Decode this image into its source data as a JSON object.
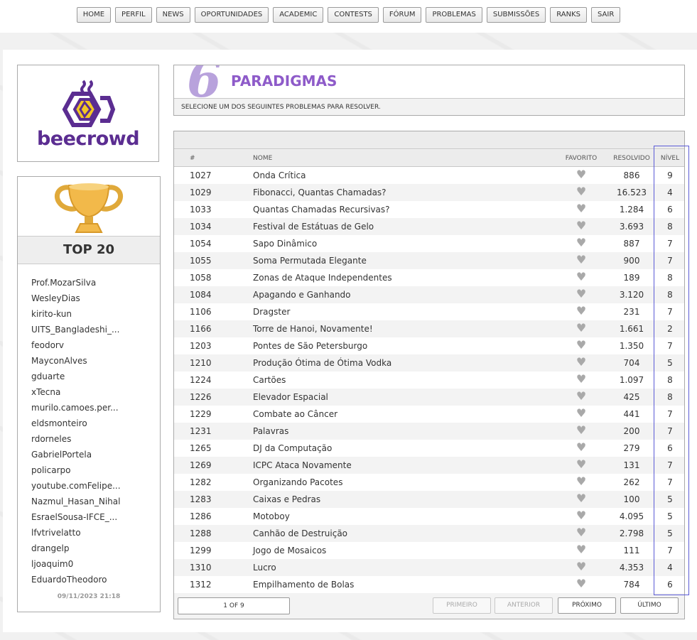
{
  "nav": [
    "HOME",
    "PERFIL",
    "NEWS",
    "OPORTUNIDADES",
    "ACADEMIC",
    "CONTESTS",
    "FÓRUM",
    "PROBLEMAS",
    "SUBMISSÕES",
    "RANKS",
    "SAIR"
  ],
  "logo": {
    "text": "beecrowd",
    "color": "#5b2d91"
  },
  "top": {
    "title": "TOP 20",
    "users": [
      "Prof.MozarSilva",
      "WesleyDias",
      "kirito-kun",
      "UITS_Bangladeshi_...",
      "feodorv",
      "MayconAlves",
      "gduarte",
      "xTecna",
      "murilo.camoes.per...",
      "eldsmonteiro",
      "rdorneles",
      "GabrielPortela",
      "policarpo",
      "youtube.comFelipe...",
      "Nazmul_Hasan_Nihal",
      "EsraelSousa-IFCE_...",
      "lfvtrivelatto",
      "drangelp",
      "ljoaquim0",
      "EduardoTheodoro"
    ],
    "date": "09/11/2023 21:18"
  },
  "category": {
    "number": "6",
    "title": "PARADIGMAS",
    "subtitle": "SELECIONE UM DOS SEGUINTES PROBLEMAS PARA RESOLVER.",
    "accent": "#8e5bc9"
  },
  "table": {
    "headers": {
      "id": "#",
      "name": "NOME",
      "fav": "FAVORITO",
      "solved": "RESOLVIDO",
      "level": "NÍVEL"
    },
    "rows": [
      {
        "id": "1027",
        "name": "Onda Crítica",
        "solved": "886",
        "level": "9"
      },
      {
        "id": "1029",
        "name": "Fibonacci, Quantas Chamadas?",
        "solved": "16.523",
        "level": "4"
      },
      {
        "id": "1033",
        "name": "Quantas Chamadas Recursivas?",
        "solved": "1.284",
        "level": "6"
      },
      {
        "id": "1034",
        "name": "Festival de Estátuas de Gelo",
        "solved": "3.693",
        "level": "8"
      },
      {
        "id": "1054",
        "name": "Sapo Dinâmico",
        "solved": "887",
        "level": "7"
      },
      {
        "id": "1055",
        "name": "Soma Permutada Elegante",
        "solved": "900",
        "level": "7"
      },
      {
        "id": "1058",
        "name": "Zonas de Ataque Independentes",
        "solved": "189",
        "level": "8"
      },
      {
        "id": "1084",
        "name": "Apagando e Ganhando",
        "solved": "3.120",
        "level": "8"
      },
      {
        "id": "1106",
        "name": "Dragster",
        "solved": "231",
        "level": "7"
      },
      {
        "id": "1166",
        "name": "Torre de Hanoi, Novamente!",
        "solved": "1.661",
        "level": "2"
      },
      {
        "id": "1203",
        "name": "Pontes de São Petersburgo",
        "solved": "1.350",
        "level": "7"
      },
      {
        "id": "1210",
        "name": "Produção Ótima de Ótima Vodka",
        "solved": "704",
        "level": "5"
      },
      {
        "id": "1224",
        "name": "Cartões",
        "solved": "1.097",
        "level": "8"
      },
      {
        "id": "1226",
        "name": "Elevador Espacial",
        "solved": "425",
        "level": "8"
      },
      {
        "id": "1229",
        "name": "Combate ao Câncer",
        "solved": "441",
        "level": "7"
      },
      {
        "id": "1231",
        "name": "Palavras",
        "solved": "200",
        "level": "7"
      },
      {
        "id": "1265",
        "name": "DJ da Computação",
        "solved": "279",
        "level": "6"
      },
      {
        "id": "1269",
        "name": "ICPC Ataca Novamente",
        "solved": "131",
        "level": "7"
      },
      {
        "id": "1282",
        "name": "Organizando Pacotes",
        "solved": "262",
        "level": "7"
      },
      {
        "id": "1283",
        "name": "Caixas e Pedras",
        "solved": "100",
        "level": "5"
      },
      {
        "id": "1286",
        "name": "Motoboy",
        "solved": "4.095",
        "level": "5"
      },
      {
        "id": "1288",
        "name": "Canhão de Destruição",
        "solved": "2.798",
        "level": "5"
      },
      {
        "id": "1299",
        "name": "Jogo de Mosaicos",
        "solved": "111",
        "level": "7"
      },
      {
        "id": "1310",
        "name": "Lucro",
        "solved": "4.353",
        "level": "4"
      },
      {
        "id": "1312",
        "name": "Empilhamento de Bolas",
        "solved": "784",
        "level": "6"
      }
    ]
  },
  "pagination": {
    "info": "1 OF 9",
    "first": "PRIMEIRO",
    "prev": "ANTERIOR",
    "next": "PRÓXIMO",
    "last": "ÚLTIMO"
  },
  "icons": {
    "favorite": "heart-icon",
    "trophy": "trophy-icon",
    "logo": "beecrowd-logo-icon"
  }
}
